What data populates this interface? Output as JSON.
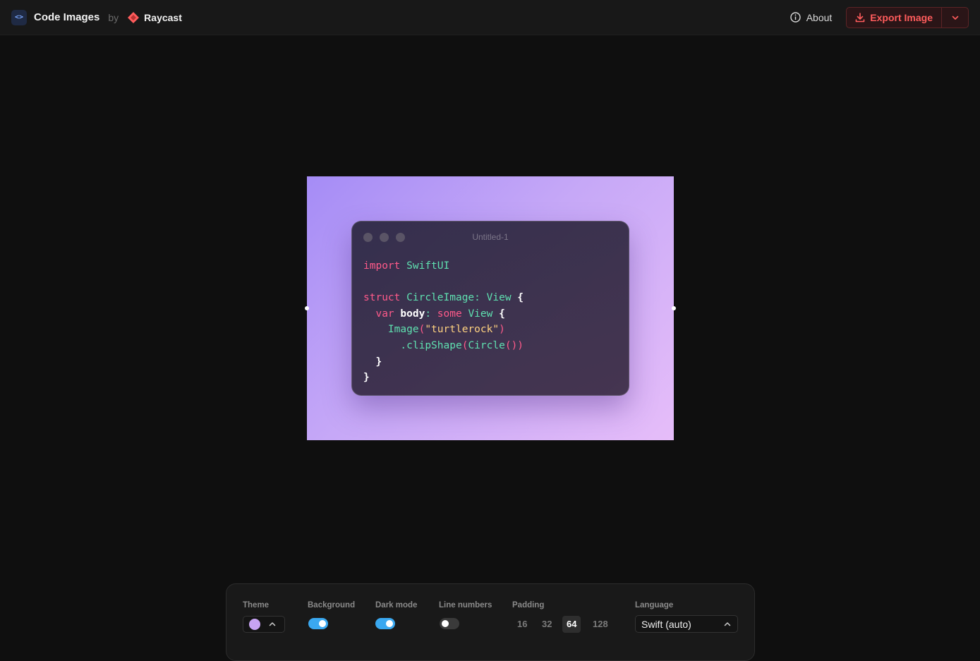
{
  "header": {
    "app_icon_glyph": "<>",
    "app_title": "Code Images",
    "by_text": "by",
    "brand": "Raycast",
    "about_label": "About",
    "export_label": "Export Image",
    "accent_color": "#ff5c5c"
  },
  "editor": {
    "window_title": "Untitled-1",
    "language": "Swift",
    "code_lines": [
      "import SwiftUI",
      "",
      "struct CircleImage: View {",
      "  var body: some View {",
      "    Image(\"turtlerock\")",
      "      .clipShape(Circle())",
      "  }",
      "}"
    ],
    "background_gradient": [
      "#a58cf6",
      "#e6bdf9"
    ]
  },
  "controls": {
    "theme": {
      "label": "Theme",
      "swatch_color": "#c7a3f2"
    },
    "background": {
      "label": "Background",
      "on": true
    },
    "dark_mode": {
      "label": "Dark mode",
      "on": true
    },
    "line_numbers": {
      "label": "Line numbers",
      "on": false
    },
    "padding": {
      "label": "Padding",
      "options": [
        "16",
        "32",
        "64",
        "128"
      ],
      "selected": "64"
    },
    "language": {
      "label": "Language",
      "value": "Swift (auto)"
    }
  }
}
